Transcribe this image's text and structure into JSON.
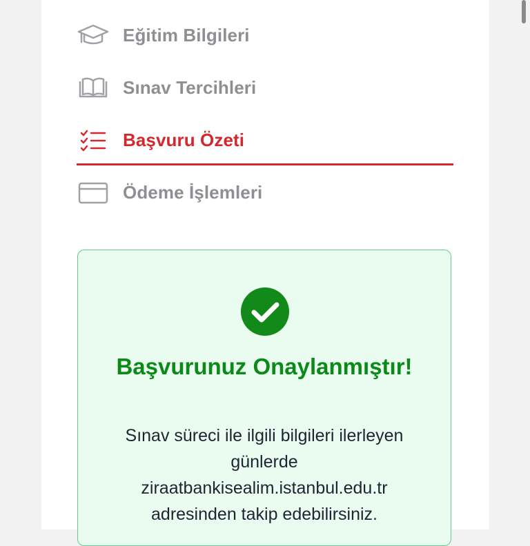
{
  "nav": {
    "items": [
      {
        "label": "Eğitim Bilgileri",
        "icon": "graduation-cap-icon",
        "active": false
      },
      {
        "label": "Sınav Tercihleri",
        "icon": "open-book-icon",
        "active": false
      },
      {
        "label": "Başvuru Özeti",
        "icon": "checklist-icon",
        "active": true
      },
      {
        "label": "Ödeme İşlemleri",
        "icon": "credit-card-icon",
        "active": false
      }
    ]
  },
  "success": {
    "icon": "check-circle-icon",
    "title": "Başvurunuz Onaylanmıştır!",
    "message_lines": [
      "Sınav süreci ile ilgili bilgileri ilerleyen",
      "günlerde",
      "ziraatbankisealim.istanbul.edu.tr",
      "adresinden takip edebilirsiniz."
    ]
  },
  "colors": {
    "active": "#d3282c",
    "inactive": "#8e8e93",
    "success_bg": "#e9fcef",
    "success_border": "#62cd8a",
    "success_title": "#0b8a1a",
    "check_circle": "#118a1a"
  }
}
